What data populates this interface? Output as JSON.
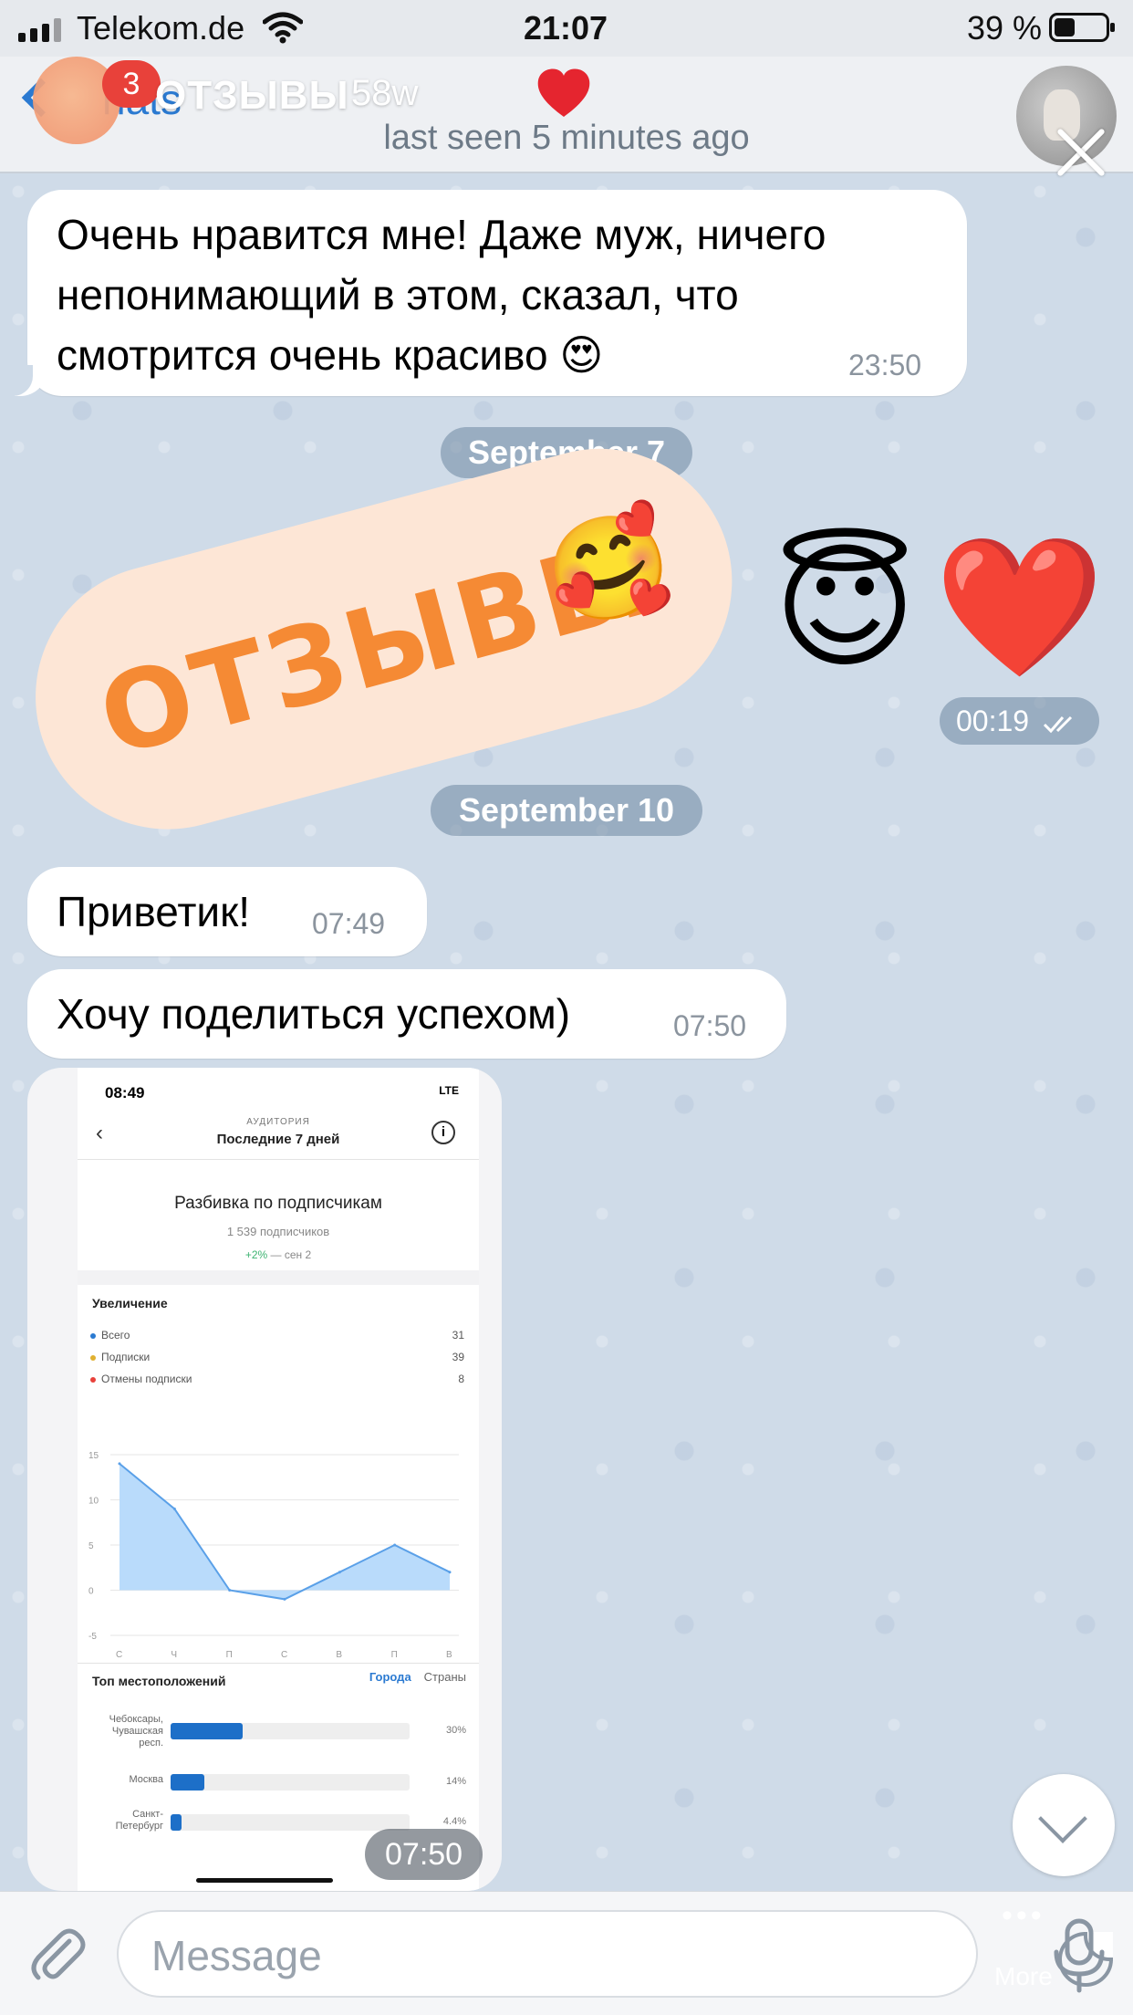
{
  "status_bar": {
    "carrier": "Telekom.de",
    "time": "21:07",
    "battery": "39 %"
  },
  "header": {
    "back_label": "hats",
    "unread_badge": "3",
    "story_title": "ОТЗЫВЫ",
    "story_age": "58w",
    "heart": "❤️",
    "last_seen": "last seen 5 minutes ago"
  },
  "messages": [
    {
      "text": "Очень нравится мне! Даже муж, ничего непонимающий в этом, сказал, что смотрится очень красиво 😍",
      "time": "23:50"
    },
    {
      "text": "Приветик!",
      "time": "07:49"
    },
    {
      "text": "Хочу поделиться успехом)",
      "time": "07:50"
    }
  ],
  "date_dividers": [
    "September 7",
    "September 10"
  ],
  "sticker": {
    "text": "ОТЗЫВЫ",
    "emoji": "🥰"
  },
  "emoji_message": {
    "emoji_1": "😇",
    "emoji_2": "❤️",
    "time": "00:19"
  },
  "screenshot_message": {
    "time": "07:50",
    "phone": {
      "status_time": "08:49",
      "status_right": "LTE",
      "caption": "АУДИТОРИЯ",
      "title": "Последние 7 дней",
      "heading": "Разбивка по подписчикам",
      "followers": "1 539 подписчиков",
      "delta_pct": "+2%",
      "delta_date": "— сен 2",
      "growth_title": "Увеличение",
      "legend": [
        {
          "label": "Всего",
          "value": "31",
          "color": "#2b7ad1"
        },
        {
          "label": "Подписки",
          "value": "39",
          "color": "#e0b030"
        },
        {
          "label": "Отмены подписки",
          "value": "8",
          "color": "#e8413a"
        }
      ],
      "locations_title": "Топ местоположений",
      "tab_cities": "Города",
      "tab_countries": "Страны",
      "locations": [
        {
          "name": "Чебоксары, Чувашская респ.",
          "pct": "30%",
          "share": 0.3
        },
        {
          "name": "Москва",
          "pct": "14%",
          "share": 0.14
        },
        {
          "name": "Санкт-Петербург",
          "pct": "4.4%",
          "share": 0.044
        }
      ],
      "chart_data": {
        "type": "area",
        "categories": [
          "С",
          "Ч",
          "П",
          "С",
          "В",
          "П",
          "В"
        ],
        "series": [
          {
            "values": [
              14,
              9,
              0,
              -1,
              2,
              5,
              2
            ]
          }
        ],
        "yticks": [
          15,
          10,
          5,
          0,
          -5
        ],
        "ylim": [
          -5,
          15
        ],
        "grid": true,
        "fill_color": "#b9dbfb",
        "line_color": "#5aa0e8"
      }
    }
  },
  "input_bar": {
    "placeholder": "Message"
  },
  "overlay": {
    "more_dots": "•••",
    "more_label": "More"
  },
  "colors": {
    "accent": "#2b7ad1",
    "badge": "#e8413a",
    "sticker_text": "#f58a34"
  }
}
